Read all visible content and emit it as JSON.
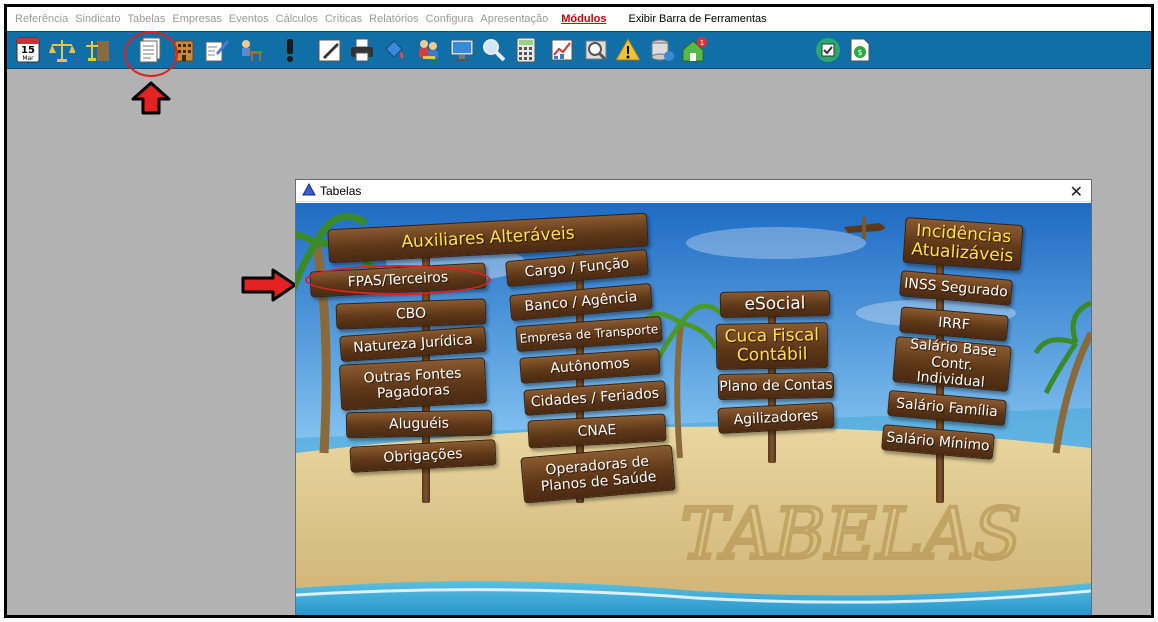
{
  "menu": {
    "items": [
      "Referência",
      "Sindicato",
      "Tabelas",
      "Empresas",
      "Eventos",
      "Cálculos",
      "Críticas",
      "Relatórios",
      "Configura",
      "Apresentação"
    ],
    "active": "Módulos",
    "extra": "Exibir Barra de Ferramentas"
  },
  "toolbar": {
    "calendar_day": "15",
    "calendar_month": "Mar"
  },
  "window": {
    "title": "Tabelas",
    "close": "✕"
  },
  "signs": {
    "auxiliares": "Auxiliares Alteráveis",
    "fpas": "FPAS/Terceiros",
    "cbo": "CBO",
    "natureza": "Natureza Jurídica",
    "outras_fontes": "Outras Fontes Pagadoras",
    "alugueis": "Aluguéis",
    "obrigacoes": "Obrigações",
    "cargo": "Cargo / Função",
    "banco": "Banco / Agência",
    "empresa_transporte": "Empresa de Transporte",
    "autonomos": "Autônomos",
    "cidades": "Cidades / Feriados",
    "cnae": "CNAE",
    "operadoras": "Operadoras de Planos de Saúde",
    "esocial": "eSocial",
    "cuca_fiscal": "Cuca Fiscal Contábil",
    "plano_contas": "Plano de Contas",
    "agilizadores": "Agilizadores",
    "incidencias": "Incidências Atualizáveis",
    "inss": "INSS Segurado",
    "irrf": "IRRF",
    "salario_base": "Salário Base Contr. Individual",
    "salario_familia": "Salário Família",
    "salario_minimo": "Salário Mínimo",
    "sand_text": "TABELAS"
  }
}
